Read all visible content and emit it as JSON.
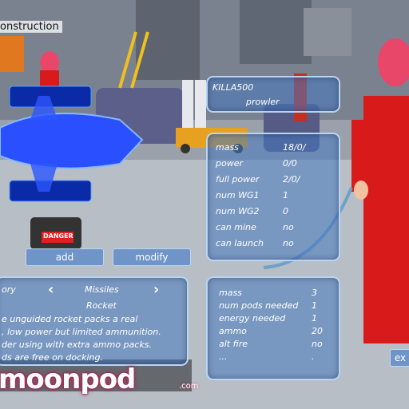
{
  "screen": {
    "title": "onstruction"
  },
  "ship": {
    "name": "KILLA500",
    "class": "prowler"
  },
  "stats": [
    {
      "label": "mass",
      "value": "18/0/"
    },
    {
      "label": "power",
      "value": "0/0"
    },
    {
      "label": "full power",
      "value": "2/0/"
    },
    {
      "label": "num WG1",
      "value": "1"
    },
    {
      "label": "num WG2",
      "value": "0"
    },
    {
      "label": "can mine",
      "value": "no"
    },
    {
      "label": "can launch",
      "value": "no"
    }
  ],
  "buttons": {
    "add": "add",
    "modify": "modify",
    "exit": "ex"
  },
  "category": {
    "label": "ory",
    "prev_glyph": "‹",
    "next_glyph": "›",
    "value": "Missiles",
    "item": "Rocket",
    "description": [
      "e unguided rocket packs a real",
      ", low power but limited ammunition.",
      "der using with extra ammo packs.",
      "ds are free on docking."
    ]
  },
  "item_stats": [
    {
      "label": "mass",
      "value": "3"
    },
    {
      "label": "num pods needed",
      "value": "1"
    },
    {
      "label": "energy needed",
      "value": "1"
    },
    {
      "label": "ammo",
      "value": "20"
    },
    {
      "label": "alt fire",
      "value": "no"
    },
    {
      "label": "...",
      "value": "."
    }
  ],
  "danger_sign": "DANGER",
  "logo": {
    "main": "moonpod",
    "suffix": ".com"
  },
  "colors": {
    "panel": "#4678be",
    "panel_border": "#b9d4f2",
    "ship_blue": "#2a4fff",
    "pilot_red": "#d81a1a",
    "hair_pink": "#e8476a"
  }
}
